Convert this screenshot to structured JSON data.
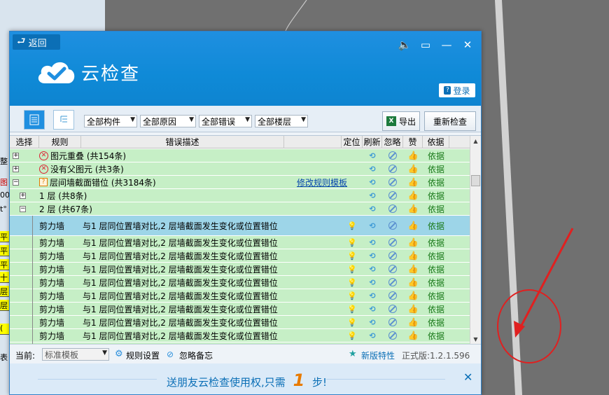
{
  "background": {
    "left_strip_chars": [
      "整",
      "图",
      "00",
      "t°",
      "平",
      "平",
      "平",
      "十",
      "层",
      "层",
      "(",
      "表"
    ]
  },
  "header": {
    "back_label": "返回",
    "app_title": "云检查",
    "login_label": "登录",
    "accent": "#1f8fe0"
  },
  "toolbar": {
    "filters": [
      "全部构件",
      "全部原因",
      "全部错误",
      "全部楼层"
    ],
    "export_label": "导出",
    "recheck_label": "重新检查"
  },
  "grid": {
    "columns": [
      "选择",
      "规则",
      "错误描述",
      "定位",
      "刷新",
      "忽略",
      "赞",
      "依据"
    ],
    "groups": [
      {
        "expander": "+",
        "icon": "error",
        "title": "图元重叠 (共154条)"
      },
      {
        "expander": "+",
        "icon": "error",
        "title": "没有父图元 (共3条)"
      },
      {
        "expander": "−",
        "icon": "warning",
        "title": "层间墙截面错位 (共3184条)",
        "link": "修改规则模板"
      }
    ],
    "subgroups": [
      {
        "expander": "+",
        "title": "1 层 (共8条)"
      },
      {
        "expander": "−",
        "title": "2 层 (共67条)"
      }
    ],
    "detail_rows": [
      {
        "type": "剪力墙",
        "desc": "与1 层同位置墙对比,2 层墙截面发生变化或位置错位"
      },
      {
        "type": "剪力墙",
        "desc": "与1 层同位置墙对比,2 层墙截面发生变化或位置错位"
      },
      {
        "type": "剪力墙",
        "desc": "与1 层同位置墙对比,2 层墙截面发生变化或位置错位"
      },
      {
        "type": "剪力墙",
        "desc": "与1 层同位置墙对比,2 层墙截面发生变化或位置错位"
      },
      {
        "type": "剪力墙",
        "desc": "与1 层同位置墙对比,2 层墙截面发生变化或位置错位"
      },
      {
        "type": "剪力墙",
        "desc": "与1 层同位置墙对比,2 层墙截面发生变化或位置错位"
      },
      {
        "type": "剪力墙",
        "desc": "与1 层同位置墙对比,2 层墙截面发生变化或位置错位"
      },
      {
        "type": "剪力墙",
        "desc": "与1 层同位置墙对比,2 层墙截面发生变化或位置错位"
      },
      {
        "type": "剪力墙",
        "desc": "与1 层同位置墙对比,2 层墙截面发生变化或位置错位"
      },
      {
        "type": "剪力墙",
        "desc": "与1 层同位置墙对比,2 层墙截面发生变化或位置错位"
      }
    ],
    "basis_label": "依据"
  },
  "footer": {
    "current_label": "当前:",
    "template_value": "标准模板",
    "rule_settings_label": "规则设置",
    "ignore_memo_label": "忽略备忘",
    "new_features_label": "新版特性",
    "version": "正式版:1.2.1.596"
  },
  "promo": {
    "text_before": "送朋友云检查使用权,只需",
    "steps": "1",
    "text_after": "步!"
  }
}
